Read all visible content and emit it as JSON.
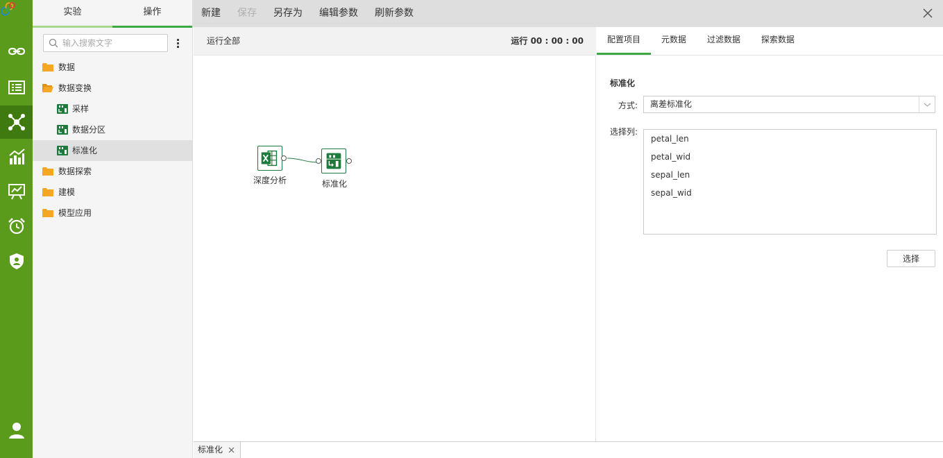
{
  "colors": {
    "rail": "#5a9b1c",
    "rail_active": "#3f7a10",
    "accent": "#3aa843",
    "folder": "#f5a623",
    "node": "#1f7a3d"
  },
  "rail": {
    "items": [
      {
        "name": "link-icon"
      },
      {
        "name": "list-icon"
      },
      {
        "name": "network-icon",
        "active": true
      },
      {
        "name": "chart-icon"
      },
      {
        "name": "presentation-icon"
      },
      {
        "name": "alarm-clock-icon"
      },
      {
        "name": "shield-icon"
      },
      {
        "name": "user-icon"
      }
    ]
  },
  "tree": {
    "tabs": [
      {
        "label": "实验"
      },
      {
        "label": "操作",
        "active": true
      }
    ],
    "search_placeholder": "输入搜索文字",
    "items": [
      {
        "label": "数据",
        "type": "folder"
      },
      {
        "label": "数据变换",
        "type": "folder-open"
      },
      {
        "label": "采样",
        "type": "node"
      },
      {
        "label": "数据分区",
        "type": "node"
      },
      {
        "label": "标准化",
        "type": "node",
        "selected": true
      },
      {
        "label": "数据探索",
        "type": "folder"
      },
      {
        "label": "建模",
        "type": "folder"
      },
      {
        "label": "模型应用",
        "type": "folder"
      }
    ]
  },
  "toolbar": {
    "new": "新建",
    "save": "保存",
    "save_as": "另存为",
    "edit_params": "编辑参数",
    "refresh_params": "刷新参数"
  },
  "canvas": {
    "run_all": "运行全部",
    "run_time": "运行 00 : 00 : 00",
    "nodes": [
      {
        "label": "深度分析",
        "icon": "excel-icon"
      },
      {
        "label": "标准化",
        "icon": "normalize-icon"
      }
    ]
  },
  "props": {
    "tabs": [
      {
        "label": "配置项目",
        "active": true
      },
      {
        "label": "元数据"
      },
      {
        "label": "过滤数据"
      },
      {
        "label": "探索数据"
      }
    ],
    "section_title": "标准化",
    "method_label": "方式:",
    "method_value": "离差标准化",
    "columns_label": "选择列:",
    "columns": [
      "petal_len",
      "petal_wid",
      "sepal_len",
      "sepal_wid"
    ],
    "select_button": "选择"
  },
  "bottom_tabs": [
    {
      "label": "标准化"
    }
  ]
}
